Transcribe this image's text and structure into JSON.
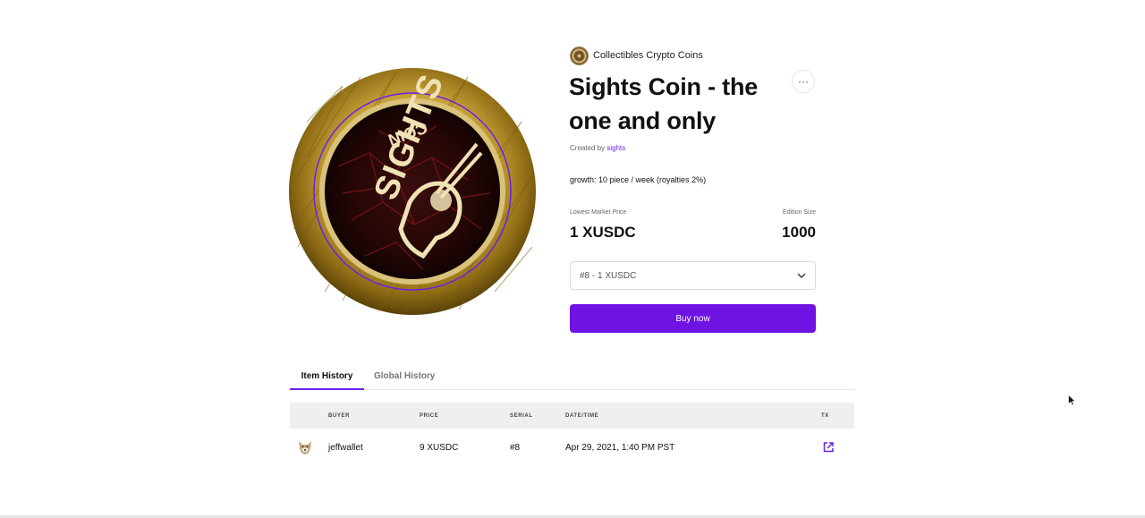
{
  "colors": {
    "accent": "#6f13e3",
    "link": "#6b21e8",
    "header_bg": "#efefef"
  },
  "collection": {
    "name": "Collectibles Crypto Coins",
    "avatar_icon": "collection-avatar"
  },
  "item": {
    "title": "Sights Coin - the one and only",
    "created_by_label": "Created by",
    "creator": "sights",
    "description": "growth: 10 piece / week (royalties 2%)",
    "coin_text_top": "COIN",
    "coin_text_main": "SIGHTS"
  },
  "more_button": {
    "label": "···",
    "icon": "ellipsis-icon"
  },
  "market": {
    "lowest_label": "Lowest Market Price",
    "lowest_value": "1 XUSDC",
    "edition_label": "Edition Size",
    "edition_value": "1000"
  },
  "select": {
    "value": "#8 - 1 XUSDC",
    "icon": "chevron-down-icon"
  },
  "buy_button": {
    "label": "Buy now"
  },
  "tabs": [
    {
      "label": "Item History",
      "active": true
    },
    {
      "label": "Global History",
      "active": false
    }
  ],
  "table": {
    "headers": {
      "buyer": "BUYER",
      "price": "PRICE",
      "serial": "SERIAL",
      "datetime": "DATE/TIME",
      "tx": "TX"
    },
    "rows": [
      {
        "buyer": "jeffwallet",
        "price": "9 XUSDC",
        "serial": "#8",
        "datetime": "Apr 29, 2021, 1:40 PM PST",
        "tx_icon": "external-link-icon"
      }
    ]
  }
}
